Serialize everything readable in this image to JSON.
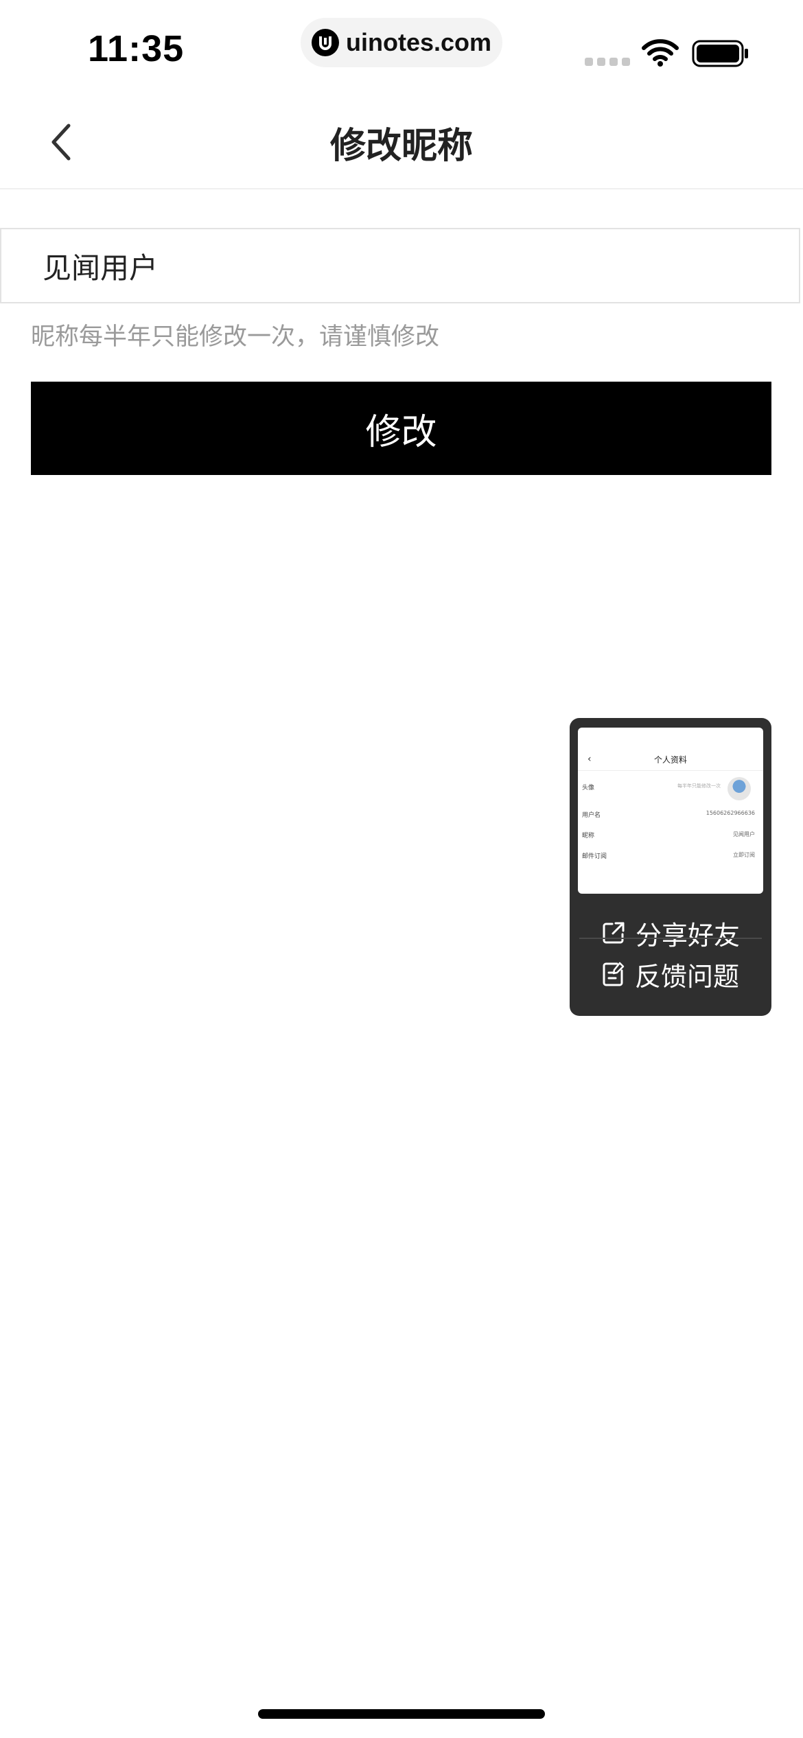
{
  "status_bar": {
    "time": "11:35",
    "url": "uinotes.com"
  },
  "nav": {
    "title": "修改昵称"
  },
  "form": {
    "nickname_value": "见闻用户",
    "hint": "昵称每半年只能修改一次，请谨慎修改",
    "submit_label": "修改"
  },
  "float_panel": {
    "preview": {
      "title": "个人资料",
      "rows": [
        {
          "label": "头像",
          "value": "每半年只能修改一次"
        },
        {
          "label": "用户名",
          "value": "15606262966636"
        },
        {
          "label": "昵称",
          "value": "见闻用户"
        },
        {
          "label": "邮件订阅",
          "value": "立即订阅"
        }
      ]
    },
    "share_label": "分享好友",
    "feedback_label": "反馈问题"
  },
  "colors": {
    "primary_button": "#000000",
    "panel_bg": "#2f2f2f",
    "hint_text": "#9a9a9a"
  },
  "icons": [
    "back-chevron-icon",
    "share-icon",
    "feedback-icon",
    "wifi-icon",
    "battery-icon",
    "signal-icon",
    "uinotes-logo-icon"
  ]
}
